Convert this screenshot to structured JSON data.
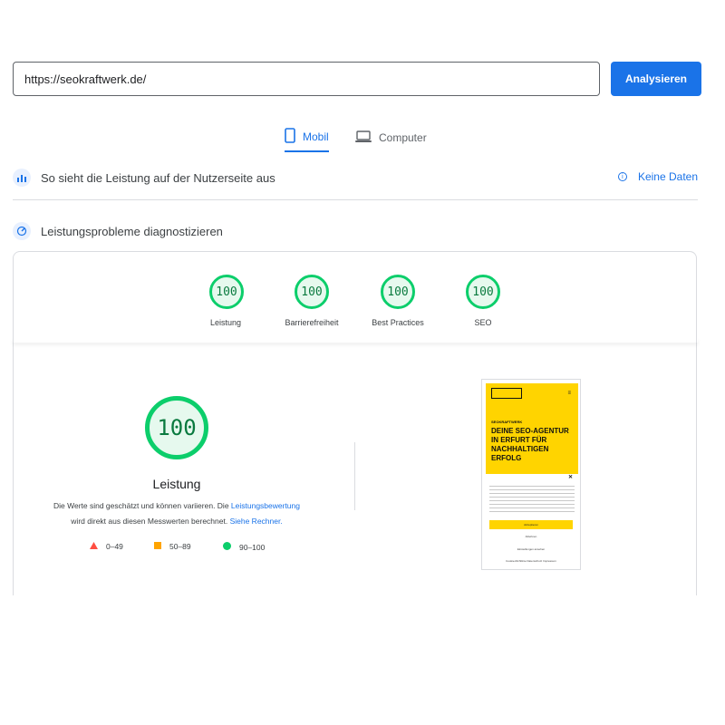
{
  "url_bar": {
    "value": "https://seokraftwerk.de/"
  },
  "analyze_button": {
    "label": "Analysieren"
  },
  "tabs": [
    {
      "label": "Mobil",
      "icon": "mobile-icon",
      "active": true
    },
    {
      "label": "Computer",
      "icon": "desktop-icon",
      "active": false
    }
  ],
  "field_data": {
    "title": "So sieht die Leistung auf der Nutzerseite aus",
    "link": "Keine Daten"
  },
  "lab_data": {
    "title": "Leistungsprobleme diagnostizieren"
  },
  "scores": [
    {
      "value": "100",
      "label": "Leistung"
    },
    {
      "value": "100",
      "label": "Barrierefreiheit"
    },
    {
      "value": "100",
      "label": "Best Practices"
    },
    {
      "value": "100",
      "label": "SEO"
    }
  ],
  "main_score": {
    "value": "100",
    "label": "Leistung",
    "desc_part1": "Die Werte sind geschätzt und können variieren. Die ",
    "desc_link1": "Leistungsbewertung",
    "desc_part2": "wird direkt aus diesen Messwerten berechnet. ",
    "desc_link2": "Siehe Rechner."
  },
  "legend": [
    {
      "range": "0–49",
      "color": "#ff4e42",
      "shape": "triangle"
    },
    {
      "range": "50–89",
      "color": "#ffa400",
      "shape": "square"
    },
    {
      "range": "90–100",
      "color": "#0cce6b",
      "shape": "circle"
    }
  ],
  "screenshot": {
    "small_label": "SEOKRAFTWERK",
    "headline": "DEINE SEO-AGENTUR IN ERFURT FÜR NACHHALTIGEN ERFOLG",
    "accept": "Akzeptieren",
    "reject": "Ablehnen",
    "settings": "Einstellungen ansehen",
    "links": "Cookie-Richtlinie   Datenschutz   Impressum"
  },
  "colors": {
    "accent": "#1a73e8",
    "pass": "#0cce6b",
    "brand_yellow": "#ffd400"
  }
}
